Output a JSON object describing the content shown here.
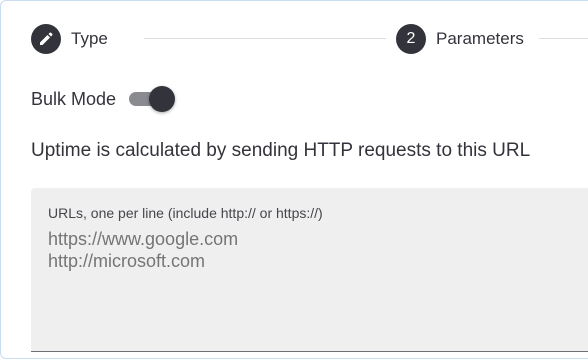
{
  "stepper": {
    "steps": [
      {
        "icon": "pencil-icon",
        "label": "Type"
      },
      {
        "number": "2",
        "label": "Parameters"
      }
    ]
  },
  "bulk_mode": {
    "label": "Bulk Mode",
    "enabled": true
  },
  "description": "Uptime is calculated by sending HTTP requests to this URL",
  "urls_field": {
    "label": "URLs, one per line (include http:// or https://)",
    "placeholder": "https://www.google.com\nhttp://microsoft.com",
    "value": ""
  },
  "colors": {
    "accent": "#33343b",
    "field_bg": "#efeff0",
    "border": "#c9ddf0"
  }
}
